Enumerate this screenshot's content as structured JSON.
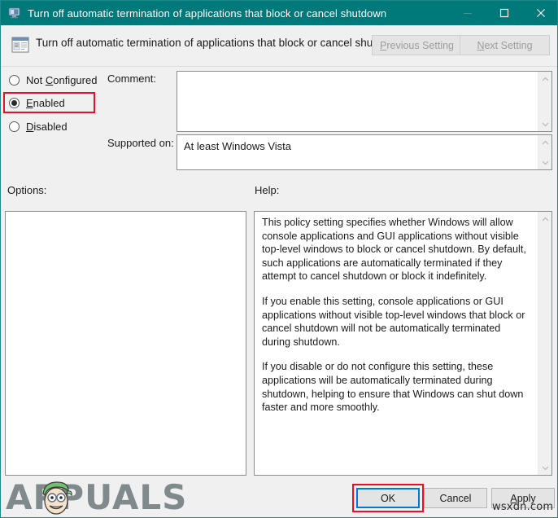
{
  "window": {
    "title": "Turn off automatic termination of applications that block or cancel shutdown",
    "icon": "computer-monitor-icon",
    "controls": {
      "minimize": "minimize-icon",
      "maximize": "maximize-icon",
      "close": "close-icon"
    }
  },
  "header": {
    "icon": "policy-setting-icon",
    "title": "Turn off automatic termination of applications that block or cancel shutdown",
    "previous_setting": "Previous Setting",
    "previous_setting_accel": "P",
    "next_setting": "Next Setting",
    "next_setting_accel": "N"
  },
  "state_options": [
    {
      "label": "Not Configured",
      "accel": "C",
      "prefix": "Not ",
      "suffix": "onfigured",
      "selected": false
    },
    {
      "label": "Enabled",
      "accel": "E",
      "prefix": "",
      "suffix": "nabled",
      "selected": true
    },
    {
      "label": "Disabled",
      "accel": "D",
      "prefix": "",
      "suffix": "isabled",
      "selected": false
    }
  ],
  "fields": {
    "comment_label": "Comment:",
    "comment_value": "",
    "comment_placeholder": "",
    "supported_on_label": "Supported on:",
    "supported_on_value": "At least Windows Vista"
  },
  "panels": {
    "options_label": "Options:",
    "options_content": "",
    "help_label": "Help:",
    "help_paragraphs": [
      "This policy setting specifies whether Windows will allow console applications and GUI applications without visible top-level windows to block or cancel shutdown. By default, such applications are automatically terminated if they attempt to cancel shutdown or block it indefinitely.",
      "If you enable this setting, console applications or GUI applications without visible top-level windows that block or cancel shutdown will not be automatically terminated during shutdown.",
      "If you disable or do not configure this setting, these applications will be automatically terminated during shutdown, helping to ensure that Windows can shut down faster and more smoothly."
    ]
  },
  "footer": {
    "ok": "OK",
    "cancel": "Cancel",
    "apply": "Apply",
    "apply_accel": "A",
    "apply_suffix": "pply"
  },
  "watermarks": {
    "brand": "APPUALS",
    "site": "wsxdn.com"
  },
  "colors": {
    "titlebar": "#00797b",
    "dialog_background": "#f0f0f0",
    "annotation_red": "#e81123",
    "focus_blue": "#0078d7",
    "text": "#1a1a1a",
    "disabled_text": "#9d9d9d"
  }
}
